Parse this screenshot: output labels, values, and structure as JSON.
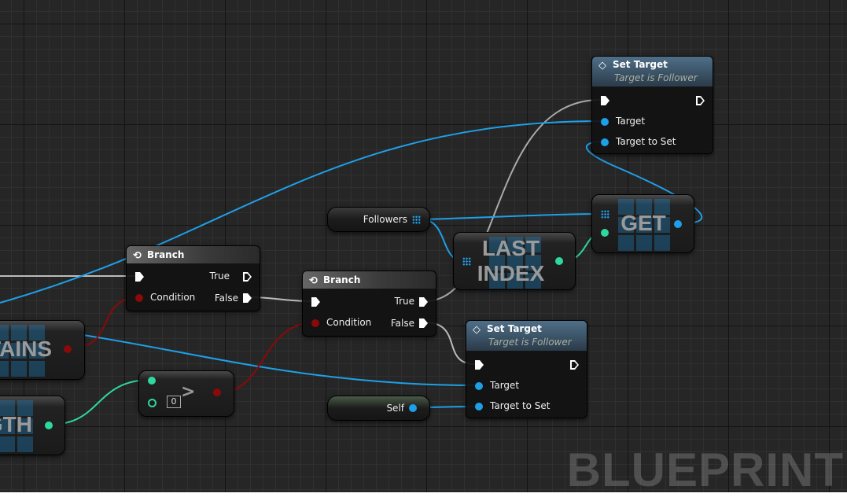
{
  "branch1": {
    "title": "Branch",
    "true_label": "True",
    "false_label": "False",
    "condition_label": "Condition"
  },
  "branch2": {
    "title": "Branch",
    "true_label": "True",
    "false_label": "False",
    "condition_label": "Condition"
  },
  "set_target_top": {
    "title": "Set Target",
    "subtitle": "Target is Follower",
    "target_label": "Target",
    "target_to_set_label": "Target to Set"
  },
  "set_target_bottom": {
    "title": "Set Target",
    "subtitle": "Target is Follower",
    "target_label": "Target",
    "target_to_set_label": "Target to Set"
  },
  "followers_var": {
    "label": "Followers"
  },
  "self_var": {
    "label": "Self"
  },
  "get_node": {
    "label": "GET"
  },
  "last_index_node": {
    "label_line1": "LAST",
    "label_line2": "INDEX"
  },
  "contains_node": {
    "label": "TAINS"
  },
  "length_node": {
    "label": "GTH"
  },
  "greater_node": {
    "operator": ">",
    "literal_value": "0"
  },
  "watermark": "BLUEPRINT",
  "colors": {
    "exec": "#ffffff",
    "object": "#1ea0e8",
    "integer": "#2ed8a0",
    "boolean": "#8a0a0a",
    "background": "#262626"
  }
}
